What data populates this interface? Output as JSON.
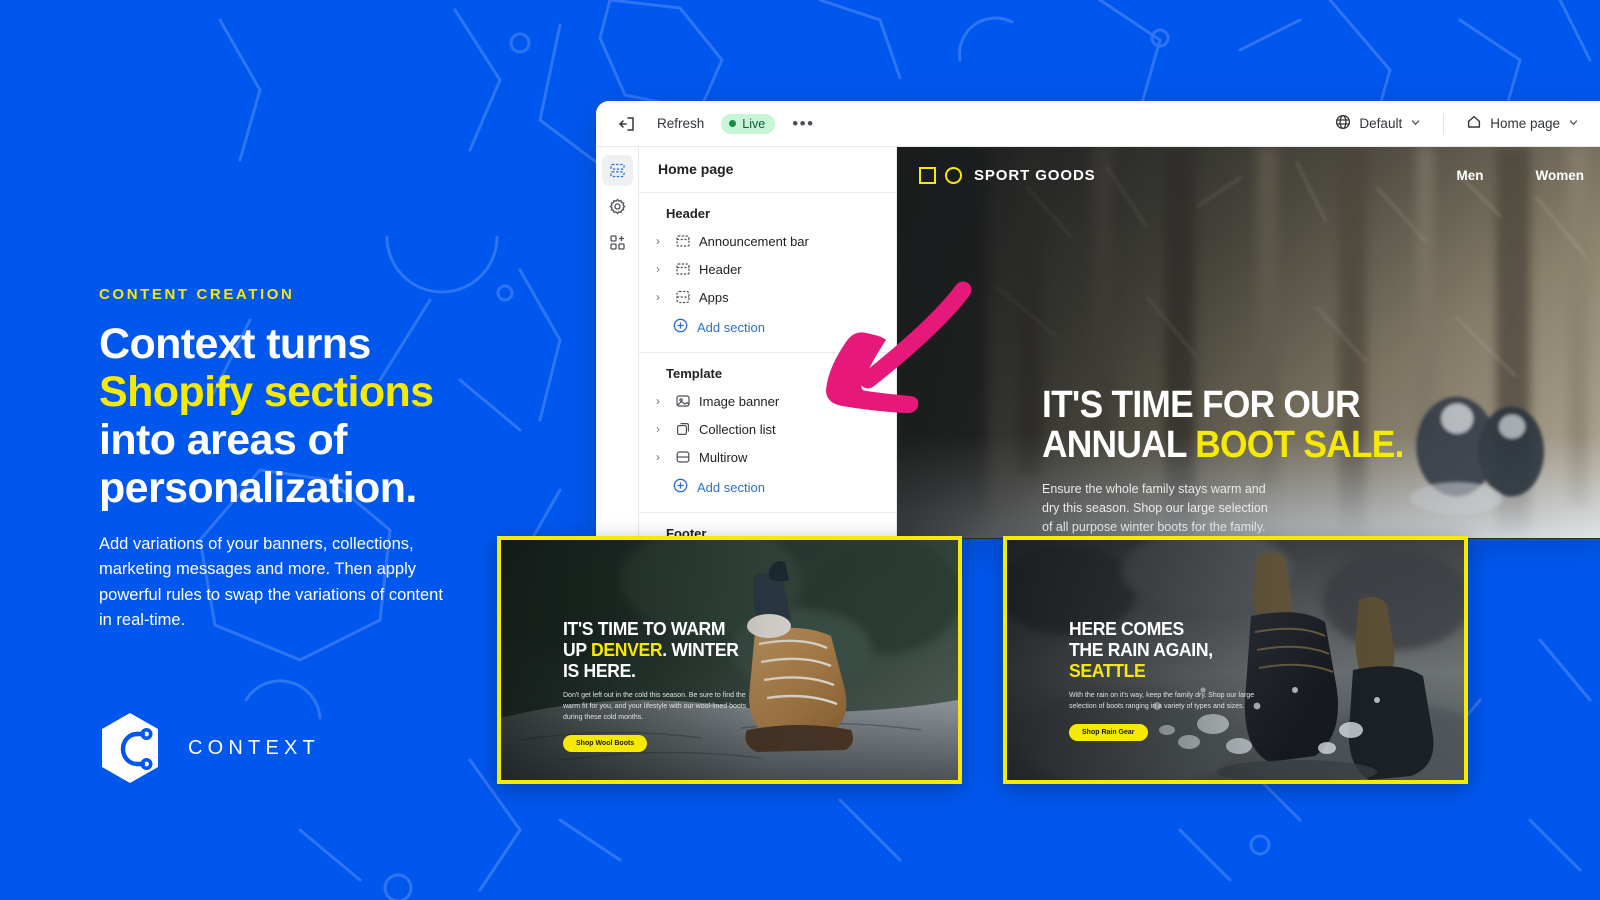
{
  "theme": {
    "background_blue": "#0057EE",
    "accent_yellow": "#F6EA00",
    "annotation_pink": "#E6197B",
    "link_blue": "#2C6ECB"
  },
  "marketing": {
    "eyebrow": "CONTENT CREATION",
    "headline_line1": "Context turns",
    "headline_line2": "Shopify sections",
    "headline_line3": "into areas of",
    "headline_line4": "personalization.",
    "body": "Add variations of your banners, collections, marketing messages and more. Then apply powerful rules to swap the variations of content in real-time.",
    "logo_wordmark": "CONTEXT"
  },
  "editor": {
    "toolbar": {
      "exit_icon": "exit-icon",
      "refresh_label": "Refresh",
      "live_label": "Live",
      "more_label": "•••",
      "market_icon": "globe-icon",
      "market_label": "Default",
      "page_icon": "home-icon",
      "page_label": "Home page"
    },
    "rail": [
      {
        "name": "sections-icon",
        "label": "Sections",
        "active": true
      },
      {
        "name": "gear-icon",
        "label": "Theme settings",
        "active": false
      },
      {
        "name": "apps-icon",
        "label": "Apps",
        "active": false
      }
    ],
    "panel_title": "Home page",
    "groups": [
      {
        "label": "Header",
        "items": [
          {
            "label": "Announcement bar",
            "icon": "announcement-icon"
          },
          {
            "label": "Header",
            "icon": "header-icon"
          },
          {
            "label": "Apps",
            "icon": "apps-section-icon"
          }
        ],
        "add_label": "Add section"
      },
      {
        "label": "Template",
        "items": [
          {
            "label": "Image banner",
            "icon": "image-icon"
          },
          {
            "label": "Collection list",
            "icon": "collection-icon"
          },
          {
            "label": "Multirow",
            "icon": "multirow-icon"
          }
        ],
        "add_label": "Add section"
      },
      {
        "label": "Footer",
        "items": [],
        "add_label": ""
      }
    ]
  },
  "storefront": {
    "brand": "SPORT GOODS",
    "nav": [
      "Men",
      "Women"
    ],
    "hero": {
      "title_line1": "IT'S TIME FOR OUR",
      "title_line2_plain": "ANNUAL ",
      "title_line2_highlight": "BOOT SALE.",
      "body": "Ensure the whole family stays warm and dry this season. Shop our large selection of all purpose winter boots for the family."
    }
  },
  "variants": [
    {
      "id": "denver-variant",
      "title_line1": "IT'S TIME TO WARM",
      "title_line2_pre": "UP ",
      "title_line2_highlight": "DENVER",
      "title_line2_post": ". WINTER",
      "title_line3": "IS HERE.",
      "body": "Don't get left out in the cold this season. Be sure to find the warm fit for you, and your lifestyle with our wool-lined boots during these cold months.",
      "cta": "Shop Wool Boots"
    },
    {
      "id": "seattle-variant",
      "title_line1": "HERE COMES",
      "title_line2": "THE RAIN AGAIN,",
      "title_line3_highlight": "SEATTLE",
      "body": "With the rain on it's way, keep the family dry. Shop our large selection of boots ranging in a variety of types and sizes.",
      "cta": "Shop Rain Gear"
    }
  ],
  "annotation": {
    "name": "pink-arrow",
    "points_to": "Image banner"
  }
}
